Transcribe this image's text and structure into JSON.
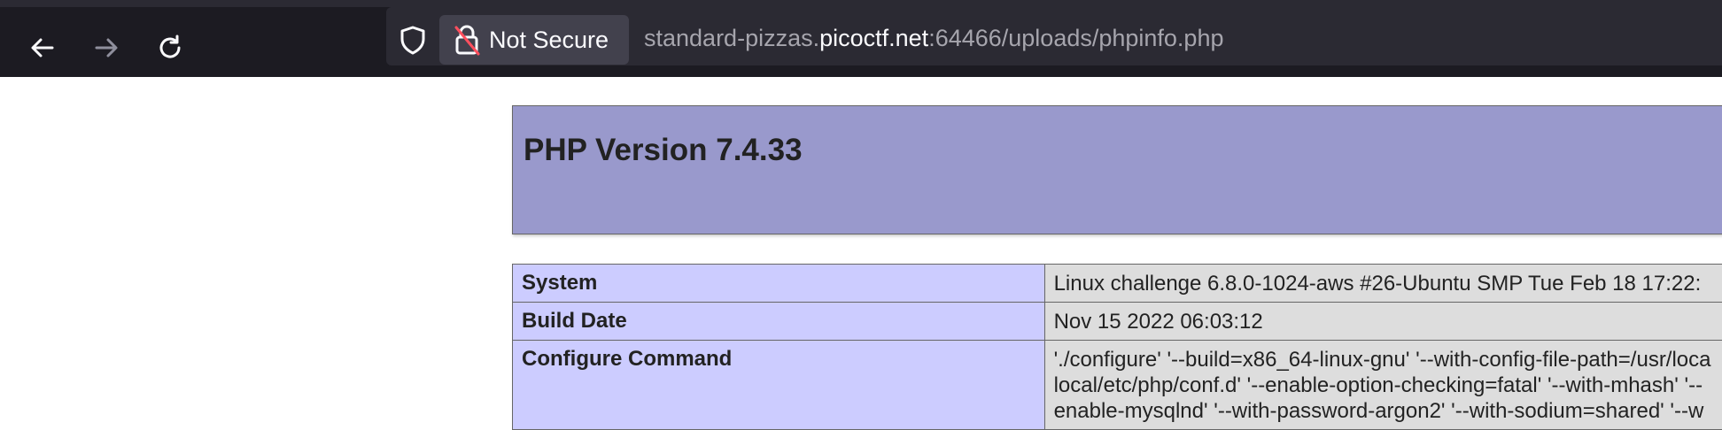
{
  "browser": {
    "security_label": "Not Secure",
    "url_prefix": "standard-pizzas.",
    "url_host": "picoctf.net",
    "url_suffix": ":64466/uploads/phpinfo.php"
  },
  "phpinfo": {
    "title": "PHP Version 7.4.33",
    "rows": [
      {
        "key": "System",
        "value": "Linux challenge 6.8.0-1024-aws #26-Ubuntu SMP Tue Feb 18 17:22:"
      },
      {
        "key": "Build Date",
        "value": "Nov 15 2022 06:03:12"
      },
      {
        "key": "Configure Command",
        "lines": [
          "'./configure' '--build=x86_64-linux-gnu' '--with-config-file-path=/usr/loca",
          "local/etc/php/conf.d' '--enable-option-checking=fatal' '--with-mhash' '--",
          "enable-mysqlnd' '--with-password-argon2' '--with-sodium=shared' '--w"
        ]
      }
    ]
  }
}
